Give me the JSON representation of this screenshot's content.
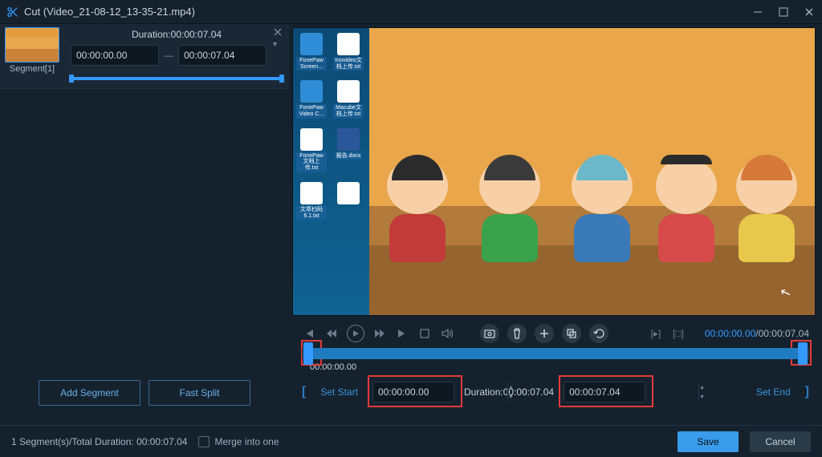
{
  "window": {
    "title": "Cut (Video_21-08-12_13-35-21.mp4)"
  },
  "segment": {
    "label": "Segment[1]",
    "duration_label": "Duration:00:00:07.04",
    "start": "00:00:00.00",
    "end": "00:00:07.04"
  },
  "left_buttons": {
    "add_segment": "Add Segment",
    "fast_split": "Fast Split"
  },
  "playback": {
    "current": "00:00:00.00",
    "total": "00:00:07.04",
    "position_label": "00:00:00.00"
  },
  "setbar": {
    "set_start": "Set Start",
    "start_value": "00:00:00.00",
    "duration_text": "Duration:00:00:07.04",
    "end_value": "00:00:07.04",
    "set_end": "Set End"
  },
  "bottom": {
    "summary": "1 Segment(s)/Total Duration: 00:00:07.04",
    "merge_label": "Merge into one",
    "save": "Save",
    "cancel": "Cancel"
  },
  "desktop_icons": [
    {
      "label": "FonePaw Screen..."
    },
    {
      "label": "Inovideo文档上传.txt"
    },
    {
      "label": "FonePaw Video C..."
    },
    {
      "label": "Macube文档上传.txt"
    },
    {
      "label": "FonePaw文档上传.txt"
    },
    {
      "label": "报告.docx"
    },
    {
      "label": "文章扫码6.1.txt"
    }
  ]
}
